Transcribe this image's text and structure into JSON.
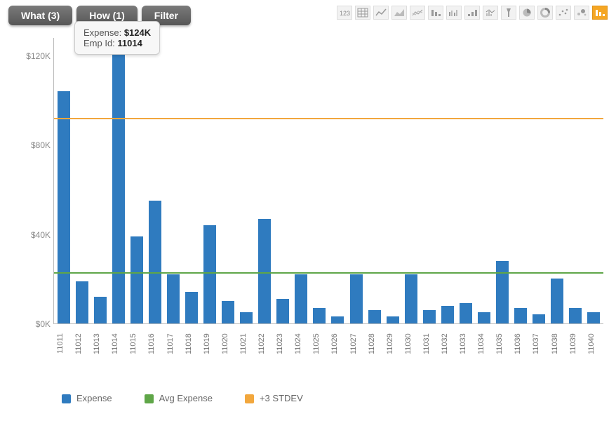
{
  "toolbar": {
    "what_label": "What (3)",
    "how_label": "How (1)",
    "filter_label": "Filter"
  },
  "tooltip": {
    "line1_label": "Expense: ",
    "line1_value": "$124K",
    "line2_label": "Emp Id: ",
    "line2_value": "11014"
  },
  "icons": [
    "number-icon",
    "grid-icon",
    "line-icon",
    "area-icon",
    "multiline-icon",
    "bar-desc-icon",
    "bar-group-icon",
    "bar-asc-icon",
    "spark-icon",
    "flashlight-icon",
    "pie-icon",
    "donut-icon",
    "scatter-icon",
    "bubble-icon",
    "highlight-icon"
  ],
  "y_ticks": [
    "$0K",
    "$40K",
    "$80K",
    "$120K"
  ],
  "legend": {
    "expense": "Expense",
    "avg": "Avg Expense",
    "stdev": "+3 STDEV"
  },
  "chart_data": {
    "type": "bar",
    "title": "",
    "xlabel": "",
    "ylabel": "",
    "ylim": [
      0,
      128
    ],
    "reference_lines": [
      {
        "name": "Avg Expense",
        "value": 23,
        "color": "#5fa648"
      },
      {
        "name": "+3 STDEV",
        "value": 92,
        "color": "#f2a73d"
      }
    ],
    "categories": [
      "11011",
      "11012",
      "11013",
      "11014",
      "11015",
      "11016",
      "11017",
      "11018",
      "11019",
      "11020",
      "11021",
      "11022",
      "11023",
      "11024",
      "11025",
      "11026",
      "11027",
      "11028",
      "11029",
      "11030",
      "11031",
      "11032",
      "11033",
      "11034",
      "11035",
      "11036",
      "11037",
      "11038",
      "11039",
      "11040"
    ],
    "values": [
      104,
      19,
      12,
      124,
      39,
      55,
      22,
      14,
      44,
      10,
      5,
      47,
      11,
      22,
      7,
      3,
      22,
      6,
      3,
      22,
      6,
      8,
      9,
      5,
      28,
      7,
      4,
      20,
      7,
      5
    ]
  }
}
